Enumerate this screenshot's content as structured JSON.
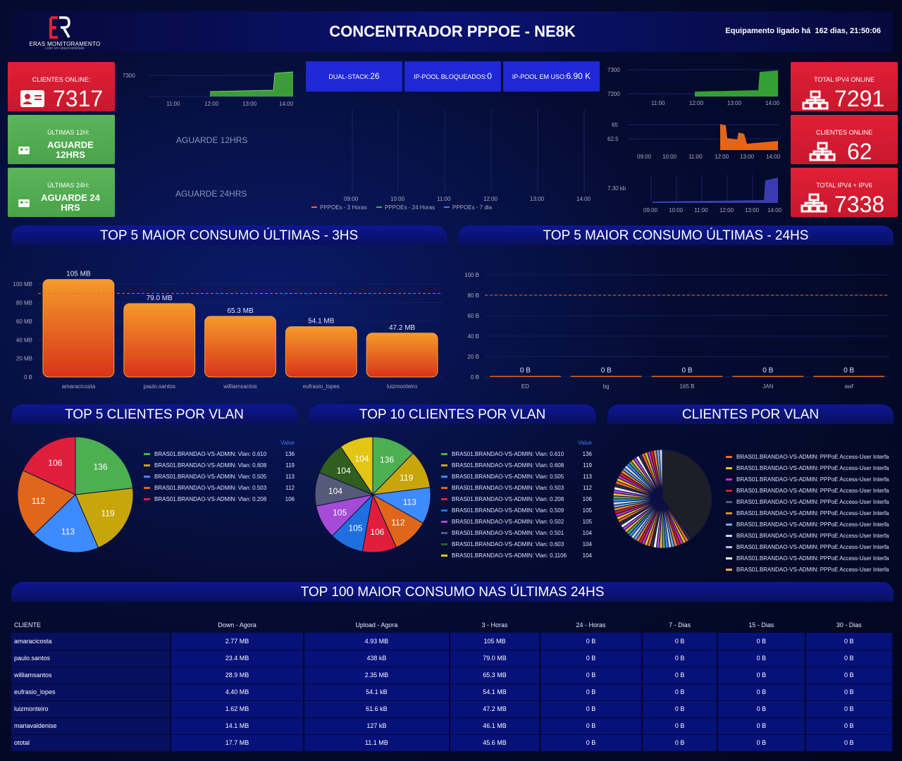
{
  "header": {
    "brand": "ERAS MONITORAMENTO",
    "tagline": "Líder em observabilidade",
    "title": "CONCENTRADOR PPPOE - NE8K",
    "uptime_label": "Equipamento ligado há",
    "uptime_value": "162 dias, 21:50:06"
  },
  "stats": {
    "clientes_online": {
      "label": "CLIENTES ONLINE:",
      "value": "7317"
    },
    "ultimas12": {
      "label": "ÚLTIMAS 12H:",
      "value": "AGUARDE 12HRS"
    },
    "ultimas24": {
      "label": "ÚLTIMAS 24H:",
      "value": "AGUARDE 24 HRS"
    },
    "ipv4_online": {
      "label": "TOTAL IPV4 ONLINE",
      "value": "7291"
    },
    "clientes_online_v6": {
      "label": "CLIENTES ONLINE",
      "value": "62"
    },
    "ipv4_ipv6": {
      "label": "TOTAL IPv4 + IPv6",
      "value": "7338"
    }
  },
  "pool": {
    "dual_label": "DUAL-STACK:",
    "dual_value": "26",
    "blocked_label": "IP-POOL BLOQUEADOS:",
    "blocked_value": "0",
    "used_label": "IP-POOL EM USO:",
    "used_value": "6.90 K"
  },
  "mini_charts": {
    "top_left": {
      "y_tick": "7300",
      "x_ticks": [
        "11:00",
        "12:00",
        "13:00",
        "14:00"
      ]
    },
    "wait12": "AGUARDE 12HRS",
    "wait24": "AGUARDE 24HRS",
    "center": {
      "x_ticks": [
        "09:00",
        "10:00",
        "11:00",
        "12:00",
        "13:00",
        "14:00"
      ],
      "legend": [
        "PPPOEs - 3 Horas",
        "PPPOEs - 24 Horas",
        "PPPOEs - 7 dia"
      ],
      "colors": [
        "#f2692a",
        "#37b34a",
        "#3a7bff"
      ]
    },
    "right1": {
      "y_ticks": [
        "7300",
        "7200"
      ],
      "x_ticks": [
        "11:00",
        "12:00",
        "13:00",
        "14:00"
      ]
    },
    "right2": {
      "y_ticks": [
        "65",
        "62.5"
      ],
      "x_ticks": [
        "09:00",
        "10:00",
        "11:00",
        "12:00",
        "13:00",
        "14:00"
      ]
    },
    "right3": {
      "y_tick": "7.30 kb",
      "x_ticks": [
        "09:00",
        "10:00",
        "11:00",
        "12:00",
        "13:00",
        "14:00"
      ]
    }
  },
  "sections": {
    "top5_3h": "TOP 5 MAIOR CONSUMO ÚLTIMAS - 3HS",
    "top5_24h": "TOP 5 MAIOR CONSUMO ÚLTIMAS - 24HS",
    "top5_vlan": "TOP 5 CLIENTES POR VLAN",
    "top10_vlan": "TOP 10 CLIENTES POR VLAN",
    "clientes_vlan": "CLIENTES POR VLAN",
    "top100": "TOP 100 MAIOR CONSUMO NAS ÚLTIMAS 24HS"
  },
  "chart_data": [
    {
      "type": "bar",
      "categories": [
        "amaracicosta",
        "paulo.santos",
        "williamsantos",
        "eufrasio_lopes",
        "luizmonteiro"
      ],
      "values": [
        105,
        79.0,
        65.3,
        54.1,
        47.2
      ],
      "value_labels": [
        "105 MB",
        "79.0 MB",
        "65.3 MB",
        "54.1 MB",
        "47.2 MB"
      ],
      "y_ticks": [
        "0 B",
        "20 MB",
        "40 MB",
        "60 MB",
        "80 MB",
        "100 MB"
      ],
      "ylim": [
        0,
        110
      ],
      "threshold": 90
    },
    {
      "type": "bar",
      "categories": [
        "ED",
        "bg",
        "165 B",
        "JAN",
        "awf"
      ],
      "values": [
        0,
        0,
        0,
        0,
        0
      ],
      "value_labels": [
        "0 B",
        "0 B",
        "0 B",
        "0 B",
        "0 B"
      ],
      "y_ticks": [
        "0 B",
        "20 B",
        "40 B",
        "60 B",
        "80 B",
        "100 B"
      ],
      "ylim": [
        0,
        100
      ],
      "threshold": 80
    },
    {
      "type": "pie",
      "value_header": "Value",
      "series": [
        {
          "name": "BRAS01.BRANDAO-VS-ADMIN: Vlan: 0.610",
          "value": 136,
          "color": "#4caf50"
        },
        {
          "name": "BRAS01.BRANDAO-VS-ADMIN: Vlan: 0.608",
          "value": 119,
          "color": "#c9a50c"
        },
        {
          "name": "BRAS01.BRANDAO-VS-ADMIN: Vlan: 0.505",
          "value": 113,
          "color": "#3d8bff"
        },
        {
          "name": "BRAS01.BRANDAO-VS-ADMIN: Vlan: 0.503",
          "value": 112,
          "color": "#e0661a"
        },
        {
          "name": "BRAS01.BRANDAO-VS-ADMIN: Vlan: 0.208",
          "value": 106,
          "color": "#e01e3c"
        }
      ]
    },
    {
      "type": "pie",
      "value_header": "Value",
      "series": [
        {
          "name": "BRAS01.BRANDAO-VS-ADMIN: Vlan: 0.610",
          "value": 136,
          "color": "#4caf50"
        },
        {
          "name": "BRAS01.BRANDAO-VS-ADMIN: Vlan: 0.608",
          "value": 119,
          "color": "#c9a50c"
        },
        {
          "name": "BRAS01.BRANDAO-VS-ADMIN: Vlan: 0.505",
          "value": 113,
          "color": "#3d8bff"
        },
        {
          "name": "BRAS01.BRANDAO-VS-ADMIN: Vlan: 0.503",
          "value": 112,
          "color": "#e0661a"
        },
        {
          "name": "BRAS01.BRANDAO-VS-ADMIN: Vlan: 0.208",
          "value": 106,
          "color": "#e01e3c"
        },
        {
          "name": "BRAS01.BRANDAO-VS-ADMIN: Vlan: 0.509",
          "value": 105,
          "color": "#1f6fe0"
        },
        {
          "name": "BRAS01.BRANDAO-VS-ADMIN: Vlan: 0.502",
          "value": 105,
          "color": "#a54bd6"
        },
        {
          "name": "BRAS01.BRANDAO-VS-ADMIN: Vlan: 0.501",
          "value": 104,
          "color": "#565a7a"
        },
        {
          "name": "BRAS01.BRANDAO-VS-ADMIN: Vlan: 0.603",
          "value": 104,
          "color": "#2f5e1e"
        },
        {
          "name": "BRAS01.BRANDAO-VS-ADMIN: Vlan: 0.1106",
          "value": 104,
          "color": "#e3c513"
        }
      ]
    },
    {
      "type": "pie",
      "legend": [
        {
          "name": "BRAS01.BRANDAO-VS-ADMIN: PPPoE Access-User Interfa",
          "color": "#f2692a"
        },
        {
          "name": "BRAS01.BRANDAO-VS-ADMIN: PPPoE Access-User Interfa",
          "color": "#e3c513"
        },
        {
          "name": "BRAS01.BRANDAO-VS-ADMIN: PPPoE Access-User Interfa",
          "color": "#c22ec2"
        },
        {
          "name": "BRAS01.BRANDAO-VS-ADMIN: PPPoE Access-User Interfa",
          "color": "#d32222"
        },
        {
          "name": "BRAS01.BRANDAO-VS-ADMIN: PPPoE Access-User Interfa",
          "color": "#565a7a"
        },
        {
          "name": "BRAS01.BRANDAO-VS-ADMIN: PPPoE Access-User Interfa",
          "color": "#e08a2a"
        },
        {
          "name": "BRAS01.BRANDAO-VS-ADMIN: PPPoE Access-User Interfa",
          "color": "#6fa8dc"
        },
        {
          "name": "BRAS01.BRANDAO-VS-ADMIN: PPPoE Access-User Interfa",
          "color": "#cfd6e6"
        },
        {
          "name": "BRAS01.BRANDAO-VS-ADMIN: PPPoE Access-User Interfa",
          "color": "#b8c4d8"
        },
        {
          "name": "BRAS01.BRANDAO-VS-ADMIN: PPPoE Access-User Interfa",
          "color": "#ffffff"
        },
        {
          "name": "BRAS01.BRANDAO-VS-ADMIN: PPPoE Access-User Interfa",
          "color": "#f5b342"
        }
      ]
    }
  ],
  "table": {
    "columns": [
      "CLIENTE",
      "Down - Agora",
      "Upload - Agora",
      "3 - Horas",
      "24 - Horas",
      "7 - Dias",
      "15 - Dias",
      "30 - Dias"
    ],
    "rows": [
      [
        "amaracicosta",
        "2.77 MB",
        "4.93 MB",
        "105 MB",
        "0 B",
        "0 B",
        "0 B",
        "0 B"
      ],
      [
        "paulo.santos",
        "23.4 MB",
        "438 kB",
        "79.0 MB",
        "0 B",
        "0 B",
        "0 B",
        "0 B"
      ],
      [
        "williamsantos",
        "28.9 MB",
        "2.35 MB",
        "65.3 MB",
        "0 B",
        "0 B",
        "0 B",
        "0 B"
      ],
      [
        "eufrasio_lopes",
        "4.40 MB",
        "54.1 kB",
        "54.1 MB",
        "0 B",
        "0 B",
        "0 B",
        "0 B"
      ],
      [
        "luizmonteiro",
        "1.62 MB",
        "61.6 kB",
        "47.2 MB",
        "0 B",
        "0 B",
        "0 B",
        "0 B"
      ],
      [
        "mariavaldenise",
        "14.1 MB",
        "127 kB",
        "46.1 MB",
        "0 B",
        "0 B",
        "0 B",
        "0 B"
      ],
      [
        "ototal",
        "17.7 MB",
        "11.1 MB",
        "45.6 MB",
        "0 B",
        "0 B",
        "0 B",
        "0 B"
      ]
    ]
  }
}
